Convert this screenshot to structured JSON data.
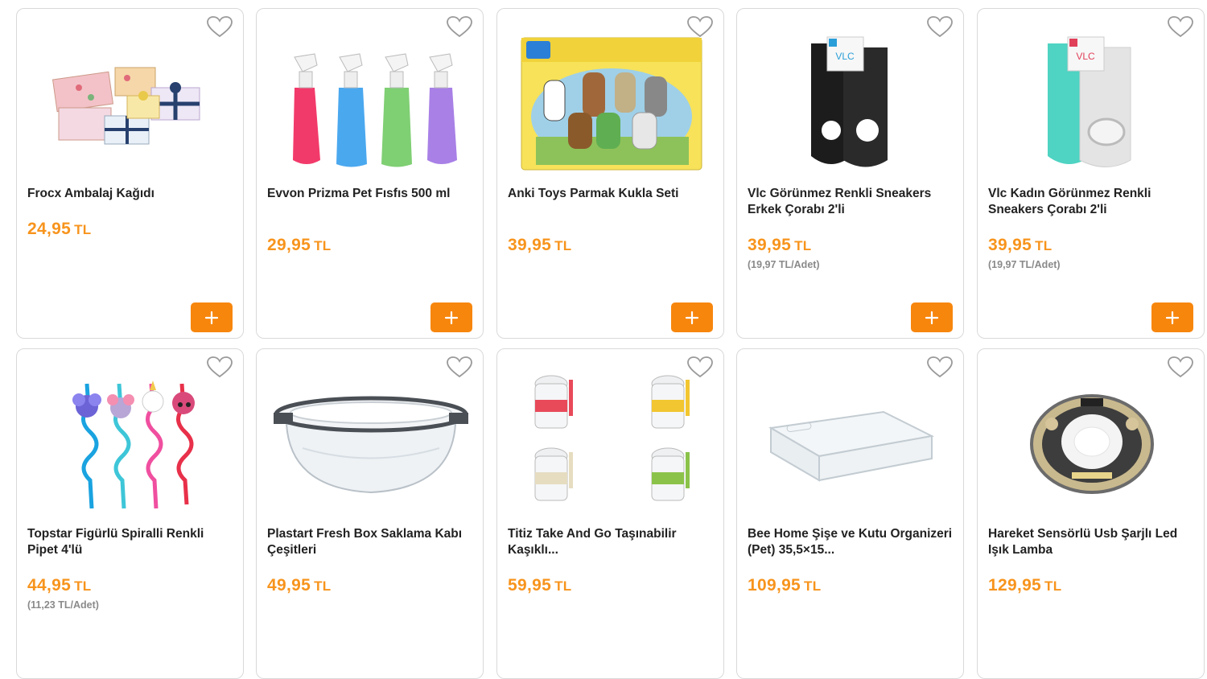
{
  "currency": "TL",
  "colors": {
    "accent": "#f7941d",
    "button": "#f7860d",
    "border": "#d9d9d9"
  },
  "products": [
    {
      "name": "Frocx Ambalaj Kağıdı",
      "price": "24,95",
      "unit_price": "",
      "image": "gift-wrap-boxes"
    },
    {
      "name": "Evvon Prizma Pet Fısfıs 500 ml",
      "price": "29,95",
      "unit_price": "",
      "image": "spray-bottles"
    },
    {
      "name": "Anki Toys Parmak Kukla Seti",
      "price": "39,95",
      "unit_price": "",
      "image": "finger-puppets"
    },
    {
      "name": "Vlc Görünmez Renkli Sneakers Erkek Çorabı 2'li",
      "price": "39,95",
      "unit_price": "(19,97 TL/Adet)",
      "image": "black-socks"
    },
    {
      "name": "Vlc Kadın Görünmez Renkli Sneakers Çorabı 2'li",
      "price": "39,95",
      "unit_price": "(19,97 TL/Adet)",
      "image": "light-socks"
    },
    {
      "name": "Topstar Figürlü Spiralli Renkli Pipet 4'lü",
      "price": "44,95",
      "unit_price": "(11,23 TL/Adet)",
      "image": "spiral-straws"
    },
    {
      "name": "Plastart Fresh Box Saklama Kabı Çeşitleri",
      "price": "49,95",
      "unit_price": "",
      "image": "storage-bowl"
    },
    {
      "name": "Titiz Take And Go Taşınabilir Kaşıklı...",
      "price": "59,95",
      "unit_price": "",
      "image": "take-and-go-cups"
    },
    {
      "name": "Bee Home Şişe ve Kutu Organizeri (Pet) 35,5×15...",
      "price": "109,95",
      "unit_price": "",
      "image": "clear-organizer"
    },
    {
      "name": "Hareket Sensörlü Usb Şarjlı Led Işık Lamba",
      "price": "129,95",
      "unit_price": "",
      "image": "led-lamp"
    }
  ]
}
